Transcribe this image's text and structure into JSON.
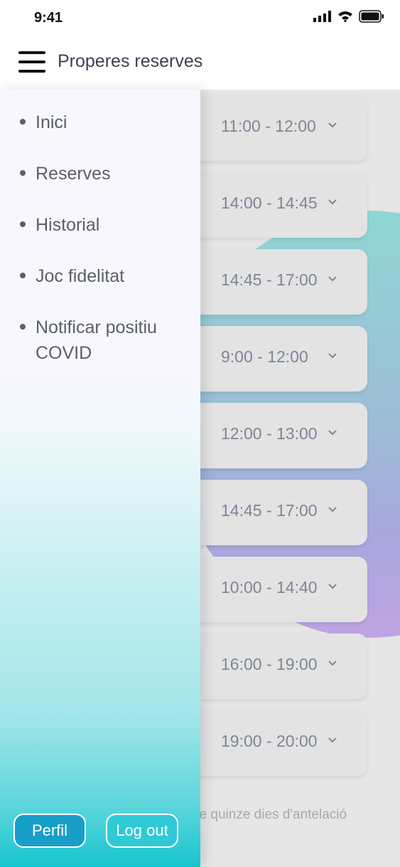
{
  "status_bar": {
    "time": "9:41",
    "icons": [
      "signal-icon",
      "wifi-icon",
      "battery-icon"
    ]
  },
  "header": {
    "title": "Properes reserves",
    "menu_icon": "hamburger-icon"
  },
  "drawer": {
    "items": [
      {
        "label": "Inici"
      },
      {
        "label": "Reserves"
      },
      {
        "label": "Historial"
      },
      {
        "label": "Joc fidelitat"
      },
      {
        "label": "Notificar positiu COVID"
      }
    ],
    "buttons": {
      "profile": "Perfil",
      "logout": "Log out"
    }
  },
  "slots": [
    {
      "time": "11:00 - 12:00"
    },
    {
      "time": "14:00 - 14:45"
    },
    {
      "time": "14:45 - 17:00"
    },
    {
      "time": "9:00 - 12:00"
    },
    {
      "time": "12:00 - 13:00"
    },
    {
      "time": "14:45 - 17:00"
    },
    {
      "time": "10:00 - 14:40"
    },
    {
      "time": "16:00 - 19:00"
    },
    {
      "time": "19:00 - 20:00"
    }
  ],
  "footer_note": "de quinze dies d'antelació",
  "colors": {
    "drawer_bottom": "#17c5cf",
    "profile_button": "#189fc9",
    "logout_button": "#2fcad6"
  }
}
